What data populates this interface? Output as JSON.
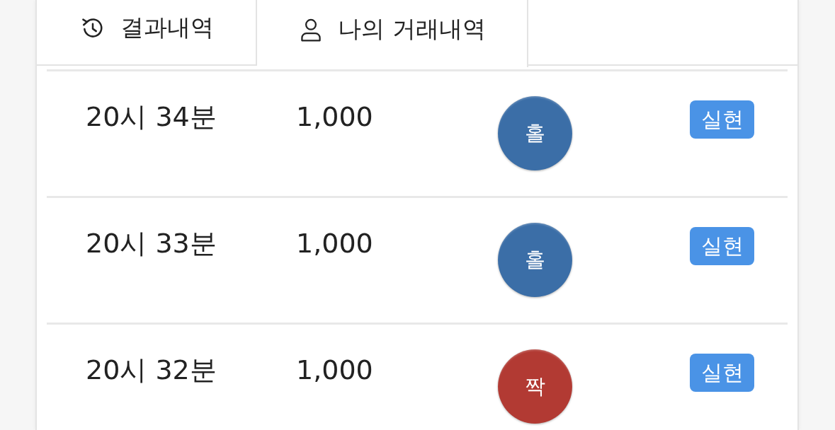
{
  "tabs": [
    {
      "label": "결과내역",
      "selected": false
    },
    {
      "label": "나의 거래내역",
      "selected": true
    }
  ],
  "rows": [
    {
      "time": "20시 34분",
      "amount": "1,000",
      "result": {
        "label": "홀",
        "color": "#3b6ea7"
      },
      "status": "실현"
    },
    {
      "time": "20시 33분",
      "amount": "1,000",
      "result": {
        "label": "홀",
        "color": "#3b6ea7"
      },
      "status": "실현"
    },
    {
      "time": "20시 32분",
      "amount": "1,000",
      "result": {
        "label": "짝",
        "color": "#b23a33"
      },
      "status": "실현"
    }
  ]
}
